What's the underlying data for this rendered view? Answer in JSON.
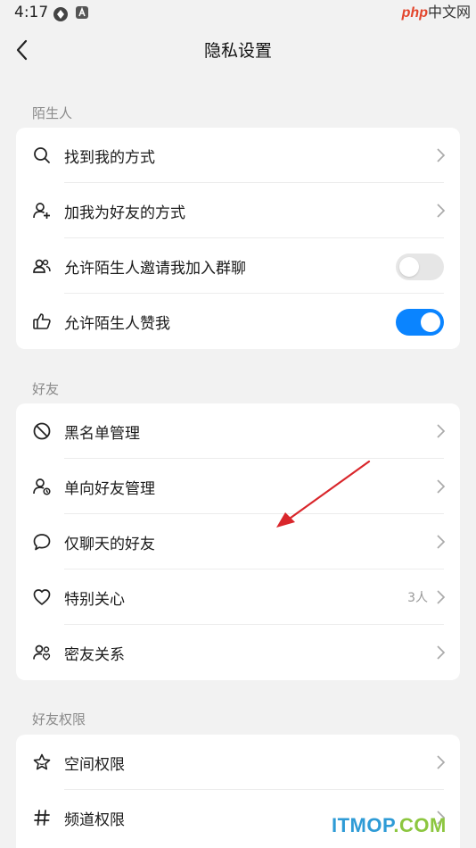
{
  "status_bar": {
    "time": "4:17"
  },
  "watermark_top": {
    "php": "php",
    "cn": "中文网"
  },
  "header": {
    "title": "隐私设置"
  },
  "sections": [
    {
      "label": "陌生人",
      "items": [
        {
          "label": "找到我的方式",
          "icon": "search-icon",
          "control": "chevron"
        },
        {
          "label": "加我为好友的方式",
          "icon": "add-user-icon",
          "control": "chevron"
        },
        {
          "label": "允许陌生人邀请我加入群聊",
          "icon": "group-icon",
          "control": "toggle",
          "toggle_on": false
        },
        {
          "label": "允许陌生人赞我",
          "icon": "thumbs-up-icon",
          "control": "toggle",
          "toggle_on": true
        }
      ]
    },
    {
      "label": "好友",
      "items": [
        {
          "label": "黑名单管理",
          "icon": "block-icon",
          "control": "chevron"
        },
        {
          "label": "单向好友管理",
          "icon": "one-way-friend-icon",
          "control": "chevron"
        },
        {
          "label": "仅聊天的好友",
          "icon": "chat-bubble-icon",
          "control": "chevron"
        },
        {
          "label": "特别关心",
          "icon": "heart-icon",
          "control": "chevron",
          "extra": "3人"
        },
        {
          "label": "密友关系",
          "icon": "close-friends-icon",
          "control": "chevron"
        }
      ]
    },
    {
      "label": "好友权限",
      "items": [
        {
          "label": "空间权限",
          "icon": "star-icon",
          "control": "chevron"
        },
        {
          "label": "频道权限",
          "icon": "hash-icon",
          "control": "chevron"
        }
      ]
    }
  ],
  "watermark_bottom": {
    "a": "ITMOP",
    "b": ".COM"
  },
  "colors": {
    "accent": "#0a84ff",
    "background": "#f2f2f2",
    "annotation_arrow": "#d9262b"
  }
}
